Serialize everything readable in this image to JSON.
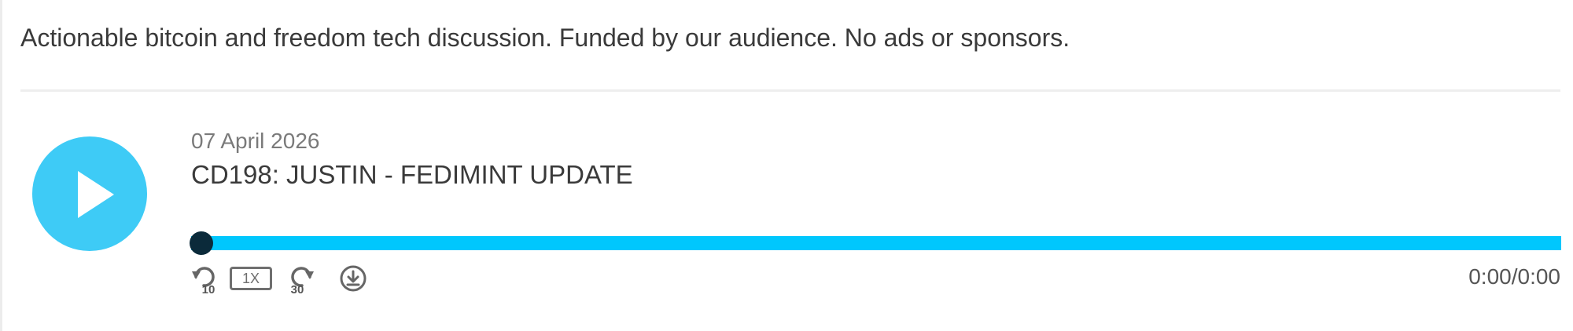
{
  "podcast": {
    "description": "Actionable bitcoin and freedom tech discussion. Funded by our audience. No ads or sponsors."
  },
  "episode": {
    "date": "07 April 2026",
    "title": "CD198: JUSTIN - FEDIMINT UPDATE"
  },
  "player": {
    "play_icon": "play-icon",
    "progress": 0,
    "rewind_label": "10",
    "speed_label": "1X",
    "forward_label": "30",
    "download_icon": "download-icon",
    "current_time": "0:00",
    "time_separator": "/",
    "duration": "0:00"
  },
  "colors": {
    "play_button": "#3ecbf6",
    "progress_track": "#00c7fd",
    "progress_knob": "#0b2a3a"
  }
}
